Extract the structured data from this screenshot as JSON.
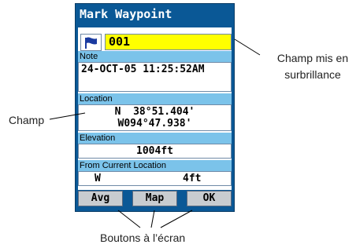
{
  "dialog": {
    "title": "Mark Waypoint",
    "waypoint_name": "001",
    "flag_icon": "flag-icon",
    "note_label": "Note",
    "note_value": "24-OCT-05 11:25:52AM",
    "location_label": "Location",
    "location_lat": "N  38°51.404'",
    "location_lon": "W094°47.938'",
    "elevation_label": "Elevation",
    "elevation_value": "1004ft",
    "from_current_label": "From Current Location",
    "from_current_direction": "W",
    "from_current_distance": "4ft",
    "buttons": [
      "Avg",
      "Map",
      "OK"
    ]
  },
  "callouts": {
    "highlighted_field": "Champ mis en surbrillance",
    "field": "Champ",
    "onscreen_buttons": "Boutons à l’écran"
  },
  "colors": {
    "screen_bg": "#0a5896",
    "label_bg": "#7bc3ea",
    "highlight": "#ffff00"
  }
}
